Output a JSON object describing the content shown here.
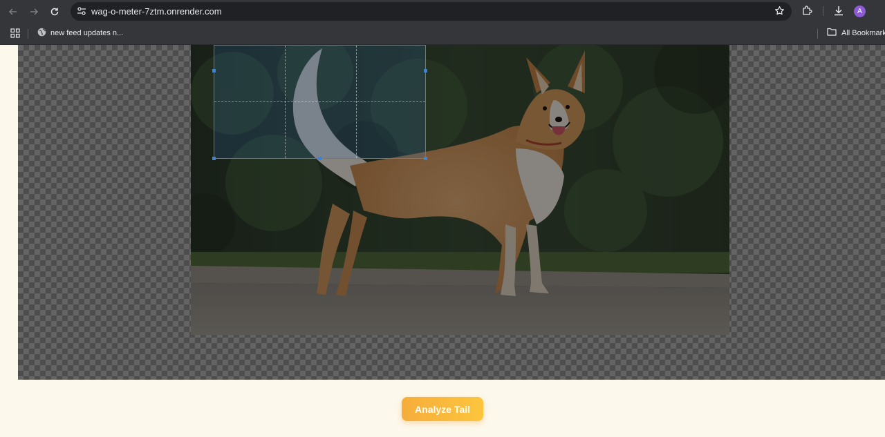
{
  "browser": {
    "url": "wag-o-meter-7ztm.onrender.com",
    "profile_initial": "A",
    "icons": [
      "back-icon",
      "forward-icon",
      "reload-icon",
      "site-info-icon",
      "star-icon",
      "extensions-icon",
      "download-icon",
      "apps-icon",
      "globe-icon",
      "folder-icon"
    ]
  },
  "bookmarks": {
    "items": [
      {
        "label": "new feed updates n..."
      }
    ],
    "all_bookmarks": "All Bookmarks"
  },
  "cropper": {
    "image_subject": "dog-photo",
    "checker_colors": [
      "#7b7b7b",
      "#5e5e5e"
    ],
    "selection_color": "#3b82d8"
  },
  "actions": {
    "analyze_label": "Analyze Tail",
    "accent": "#f6ad3b"
  }
}
